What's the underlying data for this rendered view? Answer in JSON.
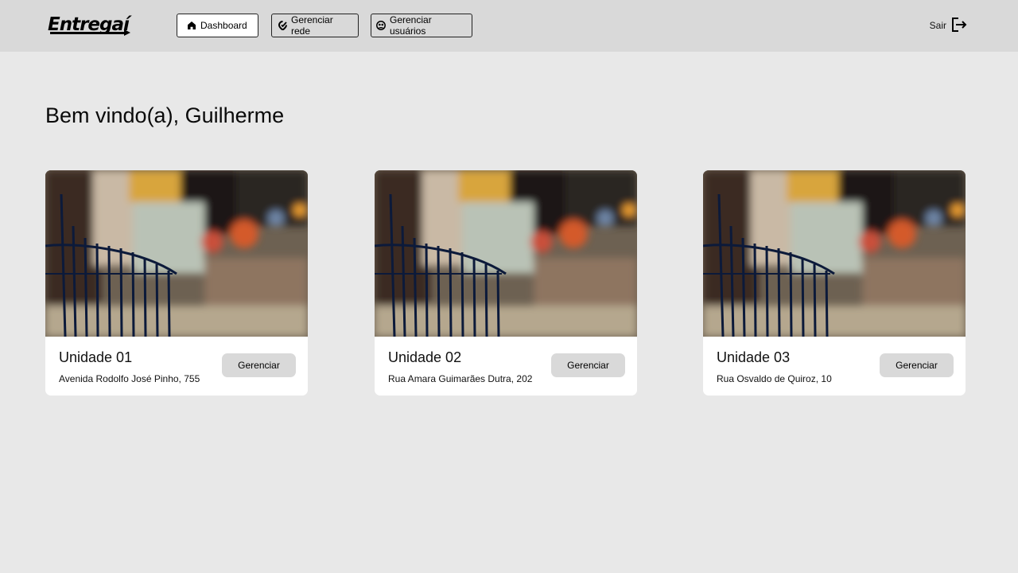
{
  "header": {
    "logo_text": "Entregaí",
    "nav": [
      {
        "label": "Dashboard",
        "icon": "home-icon",
        "active": true
      },
      {
        "label": "Gerenciar rede",
        "icon": "network-icon",
        "active": false
      },
      {
        "label": "Gerenciar usuários",
        "icon": "users-icon",
        "active": false
      }
    ],
    "logout_label": "Sair",
    "logout_icon": "logout-icon"
  },
  "main": {
    "welcome": "Bem vindo(a), Guilherme",
    "units": [
      {
        "title": "Unidade 01",
        "address": "Avenida Rodolfo José Pinho, 755",
        "button": "Gerenciar"
      },
      {
        "title": "Unidade 02",
        "address": "Rua Amara Guimarães Dutra, 202",
        "button": "Gerenciar"
      },
      {
        "title": "Unidade 03",
        "address": "Rua Osvaldo de Quiroz, 10",
        "button": "Gerenciar"
      }
    ]
  },
  "colors": {
    "page_bg": "#e8e8e8",
    "header_bg": "#d9d9d9",
    "card_bg": "#ffffff",
    "button_bg": "#d9d9d9"
  }
}
